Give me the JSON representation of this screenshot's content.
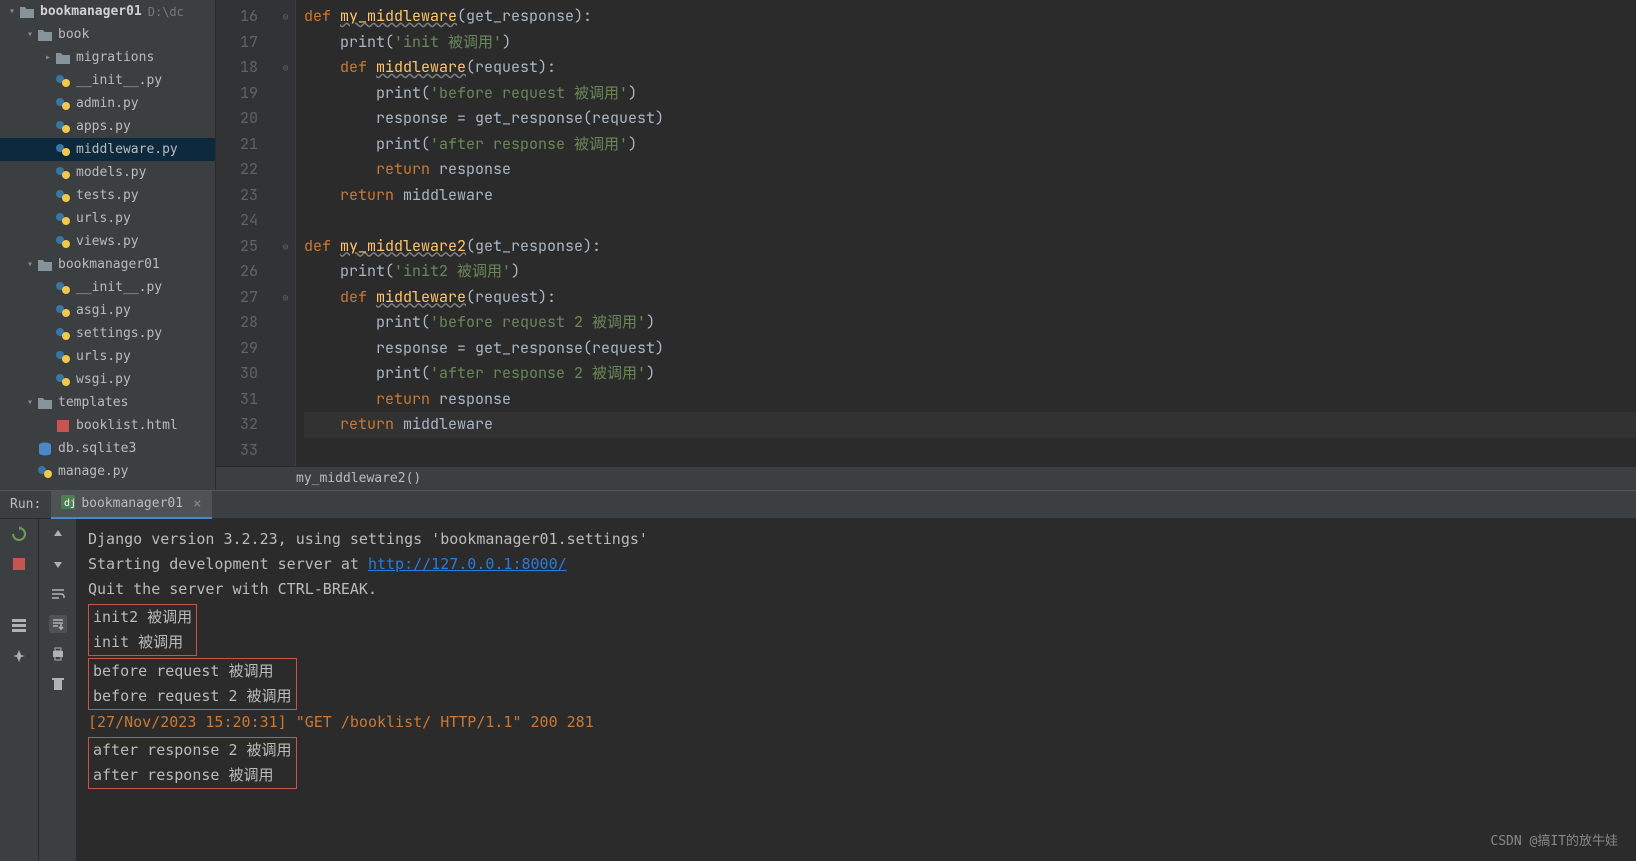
{
  "project": {
    "root": "bookmanager01",
    "root_path": "D:\\dc",
    "tree": [
      {
        "depth": 0,
        "chev": "▾",
        "icon": "folder",
        "label": "bookmanager01",
        "bold": true,
        "path": "D:\\dc",
        "sel": false
      },
      {
        "depth": 1,
        "chev": "▾",
        "icon": "folder",
        "label": "book",
        "sel": false
      },
      {
        "depth": 2,
        "chev": "▸",
        "icon": "folder",
        "label": "migrations",
        "sel": false
      },
      {
        "depth": 2,
        "chev": "",
        "icon": "py",
        "label": "__init__.py",
        "sel": false
      },
      {
        "depth": 2,
        "chev": "",
        "icon": "py",
        "label": "admin.py",
        "sel": false
      },
      {
        "depth": 2,
        "chev": "",
        "icon": "py",
        "label": "apps.py",
        "sel": false
      },
      {
        "depth": 2,
        "chev": "",
        "icon": "py",
        "label": "middleware.py",
        "sel": true
      },
      {
        "depth": 2,
        "chev": "",
        "icon": "py",
        "label": "models.py",
        "sel": false
      },
      {
        "depth": 2,
        "chev": "",
        "icon": "py",
        "label": "tests.py",
        "sel": false
      },
      {
        "depth": 2,
        "chev": "",
        "icon": "py",
        "label": "urls.py",
        "sel": false
      },
      {
        "depth": 2,
        "chev": "",
        "icon": "py",
        "label": "views.py",
        "sel": false
      },
      {
        "depth": 1,
        "chev": "▾",
        "icon": "folder",
        "label": "bookmanager01",
        "sel": false
      },
      {
        "depth": 2,
        "chev": "",
        "icon": "py",
        "label": "__init__.py",
        "sel": false
      },
      {
        "depth": 2,
        "chev": "",
        "icon": "py",
        "label": "asgi.py",
        "sel": false
      },
      {
        "depth": 2,
        "chev": "",
        "icon": "py",
        "label": "settings.py",
        "sel": false
      },
      {
        "depth": 2,
        "chev": "",
        "icon": "py",
        "label": "urls.py",
        "sel": false
      },
      {
        "depth": 2,
        "chev": "",
        "icon": "py",
        "label": "wsgi.py",
        "sel": false
      },
      {
        "depth": 1,
        "chev": "▾",
        "icon": "folder",
        "label": "templates",
        "sel": false
      },
      {
        "depth": 2,
        "chev": "",
        "icon": "html",
        "label": "booklist.html",
        "sel": false
      },
      {
        "depth": 1,
        "chev": "",
        "icon": "db",
        "label": "db.sqlite3",
        "sel": false
      },
      {
        "depth": 1,
        "chev": "",
        "icon": "py",
        "label": "manage.py",
        "sel": false
      }
    ]
  },
  "editor": {
    "first_line": 16,
    "breadcrumb": "my_middleware2()",
    "lines": [
      {
        "n": 16,
        "fold": "⊖",
        "html": "<span class='kw'>def </span><span class='fn-u'>my_middleware</span><span class='par'>(get_response):</span>"
      },
      {
        "n": 17,
        "fold": "",
        "html": "    <span class='id'>print</span><span class='par'>(</span><span class='str'>'init 被调用'</span><span class='par'>)</span>"
      },
      {
        "n": 18,
        "fold": "⊖",
        "html": "    <span class='kw'>def </span><span class='fn-u'>middleware</span><span class='par'>(request):</span>"
      },
      {
        "n": 19,
        "fold": "",
        "html": "        <span class='id'>print</span><span class='par'>(</span><span class='str'>'before request 被调用'</span><span class='par'>)</span>"
      },
      {
        "n": 20,
        "fold": "",
        "html": "        <span class='id'>response = get_response(request)</span>"
      },
      {
        "n": 21,
        "fold": "",
        "html": "        <span class='id'>print</span><span class='par'>(</span><span class='str'>'after response 被调用'</span><span class='par'>)</span>"
      },
      {
        "n": 22,
        "fold": "",
        "html": "        <span class='kw'>return </span><span class='id'>response</span>"
      },
      {
        "n": 23,
        "fold": "",
        "html": "    <span class='kw'>return </span><span class='id'>middleware</span>"
      },
      {
        "n": 24,
        "fold": "",
        "html": ""
      },
      {
        "n": 25,
        "fold": "⊖",
        "html": "<span class='kw'>def </span><span class='fn-u'>my_middleware2</span><span class='par'>(get_response):</span>"
      },
      {
        "n": 26,
        "fold": "",
        "html": "    <span class='id'>print</span><span class='par'>(</span><span class='str'>'init2 被调用'</span><span class='par'>)</span>"
      },
      {
        "n": 27,
        "fold": "⊖",
        "html": "    <span class='kw'>def </span><span class='fn-u'>middleware</span><span class='par'>(request):</span>"
      },
      {
        "n": 28,
        "fold": "",
        "html": "        <span class='id'>print</span><span class='par'>(</span><span class='str'>'before request 2 被调用'</span><span class='par'>)</span>"
      },
      {
        "n": 29,
        "fold": "",
        "html": "        <span class='id'>response = get_response(request)</span>"
      },
      {
        "n": 30,
        "fold": "",
        "html": "        <span class='id'>print</span><span class='par'>(</span><span class='str'>'after response 2 被调用'</span><span class='par'>)</span>"
      },
      {
        "n": 31,
        "fold": "",
        "html": "        <span class='kw'>return </span><span class='id'>response</span>"
      },
      {
        "n": 32,
        "fold": "",
        "html": "    <span class='kw'>return </span><span class='id'>middleware</span>",
        "hl": true
      },
      {
        "n": 33,
        "fold": "",
        "html": ""
      }
    ]
  },
  "run": {
    "label": "Run:",
    "tab": "bookmanager01",
    "lines": [
      {
        "type": "plain",
        "text": "Django version 3.2.23, using settings 'bookmanager01.settings'"
      },
      {
        "type": "link",
        "prefix": "Starting development server at ",
        "url": "http://127.0.0.1:8000/"
      },
      {
        "type": "plain",
        "text": "Quit the server with CTRL-BREAK."
      },
      {
        "type": "box-start"
      },
      {
        "type": "plain",
        "text": "init2 被调用"
      },
      {
        "type": "plain",
        "text": "init 被调用"
      },
      {
        "type": "box-end"
      },
      {
        "type": "box-start"
      },
      {
        "type": "plain",
        "text": "before request 被调用"
      },
      {
        "type": "plain",
        "text": "before request 2 被调用"
      },
      {
        "type": "box-end"
      },
      {
        "type": "log",
        "ts": "[27/Nov/2023 15:20:31]",
        "msg": " \"GET /booklist/ HTTP/1.1\" 200 281"
      },
      {
        "type": "box-start"
      },
      {
        "type": "plain",
        "text": "after response 2 被调用"
      },
      {
        "type": "plain",
        "text": "after response 被调用"
      },
      {
        "type": "box-end"
      }
    ]
  },
  "watermark": "CSDN @搞IT的放牛娃"
}
